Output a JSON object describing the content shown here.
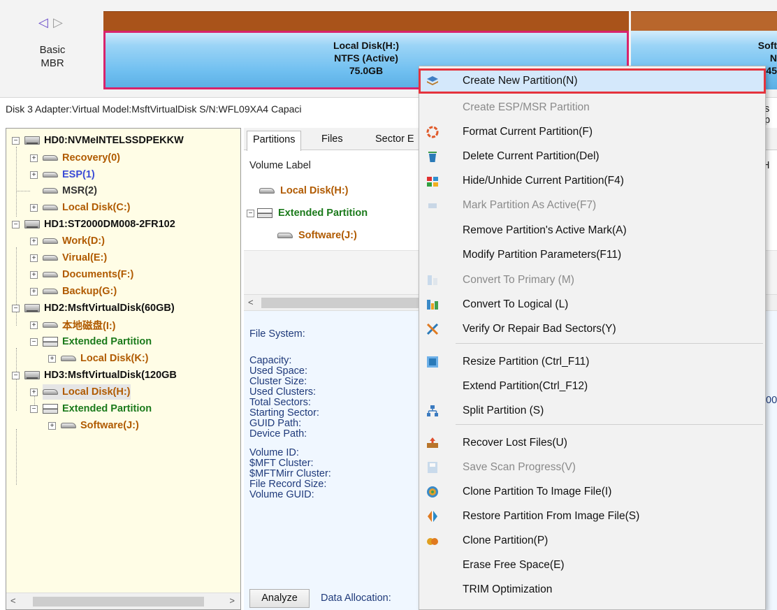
{
  "diskmap": {
    "nav_arrows": [
      "◁",
      "▷"
    ],
    "basic_label": "Basic",
    "mbr_label": "MBR",
    "partitions": [
      {
        "line1": "Local Disk(H:)",
        "line2": "NTFS (Active)",
        "line3": "75.0GB"
      },
      {
        "line1": "Soft",
        "line2": "N",
        "line3": "45"
      }
    ],
    "disk_info": "Disk 3 Adapter:Virtual  Model:MsftVirtualDisk  S/N:WFL09XA4  Capaci",
    "disk_info_tail": "s p"
  },
  "tree": {
    "nodes": [
      {
        "label": "HD0:NVMeINTELSSDPEKKW",
        "kind": "disk"
      },
      {
        "label": "Recovery(0)",
        "kind": "vol"
      },
      {
        "label": "ESP(1)",
        "kind": "esp"
      },
      {
        "label": "MSR(2)",
        "kind": "msr"
      },
      {
        "label": "Local Disk(C:)",
        "kind": "vol"
      },
      {
        "label": "HD1:ST2000DM008-2FR102",
        "kind": "disk"
      },
      {
        "label": "Work(D:)",
        "kind": "vol"
      },
      {
        "label": "Virual(E:)",
        "kind": "vol"
      },
      {
        "label": "Documents(F:)",
        "kind": "vol"
      },
      {
        "label": "Backup(G:)",
        "kind": "vol"
      },
      {
        "label": "HD2:MsftVirtualDisk(60GB)",
        "kind": "disk"
      },
      {
        "label": "本地磁盘(I:)",
        "kind": "vol"
      },
      {
        "label": "Extended Partition",
        "kind": "ext"
      },
      {
        "label": "Local Disk(K:)",
        "kind": "vol"
      },
      {
        "label": "HD3:MsftVirtualDisk(120GB",
        "kind": "disk"
      },
      {
        "label": "Local Disk(H:)",
        "kind": "vol"
      },
      {
        "label": "Extended Partition",
        "kind": "ext"
      },
      {
        "label": "Software(J:)",
        "kind": "vol"
      }
    ]
  },
  "right": {
    "tabs": [
      "Partitions",
      "Files",
      "Sector E"
    ],
    "col_header": "Volume Label",
    "col_header_right": "H",
    "rows": [
      "Local Disk(H:)",
      "Extended Partition",
      "Software(J:)"
    ],
    "labels": [
      "File System:",
      "Capacity:",
      "Used Space:",
      "Cluster Size:",
      "Used Clusters:",
      "Total Sectors:",
      "Starting Sector:",
      "GUID Path:",
      "Device Path:",
      "Volume ID:",
      "$MFT Cluster:",
      "$MFTMirr Cluster:",
      "File Record Size:",
      "Volume GUID:"
    ],
    "edge_value": "00",
    "analyze_label": "Analyze",
    "data_allocation_label": "Data Allocation:"
  },
  "menu": {
    "items": [
      {
        "label": "Create New Partition(N)",
        "icon": "create-partition-icon",
        "disabled": false
      },
      {
        "label": "Create ESP/MSR Partition",
        "icon": "",
        "disabled": true
      },
      {
        "label": "Format Current Partition(F)",
        "icon": "format-icon",
        "disabled": false
      },
      {
        "label": "Delete Current Partition(Del)",
        "icon": "recycle-bin-icon",
        "disabled": false
      },
      {
        "label": "Hide/Unhide Current Partition(F4)",
        "icon": "hide-icon",
        "disabled": false
      },
      {
        "label": "Mark Partition As Active(F7)",
        "icon": "mark-active-icon",
        "disabled": true
      },
      {
        "label": "Remove Partition's Active Mark(A)",
        "icon": "",
        "disabled": false
      },
      {
        "label": "Modify Partition Parameters(F11)",
        "icon": "",
        "disabled": false
      },
      {
        "label": "Convert To Primary (M)",
        "icon": "convert-primary-icon",
        "disabled": true
      },
      {
        "label": "Convert To Logical (L)",
        "icon": "convert-logical-icon",
        "disabled": false
      },
      {
        "label": "Verify Or Repair Bad Sectors(Y)",
        "icon": "repair-tools-icon",
        "disabled": false
      },
      {
        "label": "Resize Partition (Ctrl_F11)",
        "icon": "resize-icon",
        "disabled": false
      },
      {
        "label": "Extend Partition(Ctrl_F12)",
        "icon": "",
        "disabled": false
      },
      {
        "label": "Split Partition (S)",
        "icon": "split-icon",
        "disabled": false
      },
      {
        "label": "Recover Lost Files(U)",
        "icon": "recover-icon",
        "disabled": false
      },
      {
        "label": "Save Scan Progress(V)",
        "icon": "save-icon",
        "disabled": true
      },
      {
        "label": "Clone Partition To Image File(I)",
        "icon": "clone-image-icon",
        "disabled": false
      },
      {
        "label": "Restore Partition From Image File(S)",
        "icon": "restore-icon",
        "disabled": false
      },
      {
        "label": "Clone Partition(P)",
        "icon": "clone-icon",
        "disabled": false
      },
      {
        "label": "Erase Free Space(E)",
        "icon": "",
        "disabled": false
      },
      {
        "label": "TRIM Optimization",
        "icon": "",
        "disabled": false
      }
    ]
  },
  "colors": {
    "volume": "#b05a00",
    "extended": "#1b7a1b",
    "esp": "#3a4bd6",
    "selection_outline": "#d8246b",
    "menu_highlight_border": "#e5343d",
    "label_blue": "#1f3a7a"
  }
}
